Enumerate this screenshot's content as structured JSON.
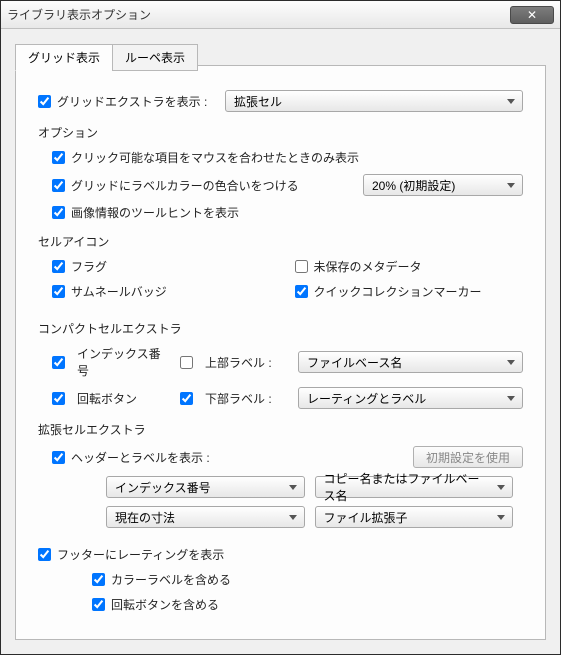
{
  "window": {
    "title": "ライブラリ表示オプション"
  },
  "tabs": {
    "grid": "グリッド表示",
    "loupe": "ルーペ表示"
  },
  "top": {
    "show_grid_extras": "グリッドエクストラを表示 :",
    "grid_extras_value": "拡張セル"
  },
  "options": {
    "title": "オプション",
    "clickable_on_hover": "クリック可能な項目をマウスを合わせたときのみ表示",
    "tint_label_color": "グリッドにラベルカラーの色合いをつける",
    "tint_amount": "20% (初期設定)",
    "show_image_tooltips": "画像情報のツールヒントを表示"
  },
  "cell_icons": {
    "title": "セルアイコン",
    "flags": "フラグ",
    "unsaved_metadata": "未保存のメタデータ",
    "thumbnail_badges": "サムネールバッジ",
    "quick_collection": "クイックコレクションマーカー"
  },
  "compact": {
    "title": "コンパクトセルエクストラ",
    "index_number": "インデックス番号",
    "top_label": "上部ラベル :",
    "top_label_value": "ファイルベース名",
    "rotation": "回転ボタン",
    "bottom_label": "下部ラベル :",
    "bottom_label_value": "レーティングとラベル"
  },
  "expanded": {
    "title": "拡張セルエクストラ",
    "show_header": "ヘッダーとラベルを表示 :",
    "use_defaults": "初期設定を使用",
    "dd1": "インデックス番号",
    "dd2": "コピー名またはファイルベース名",
    "dd3": "現在の寸法",
    "dd4": "ファイル拡張子"
  },
  "footer": {
    "show_rating": "フッターにレーティングを表示",
    "include_color_label": "カラーラベルを含める",
    "include_rotation": "回転ボタンを含める"
  }
}
